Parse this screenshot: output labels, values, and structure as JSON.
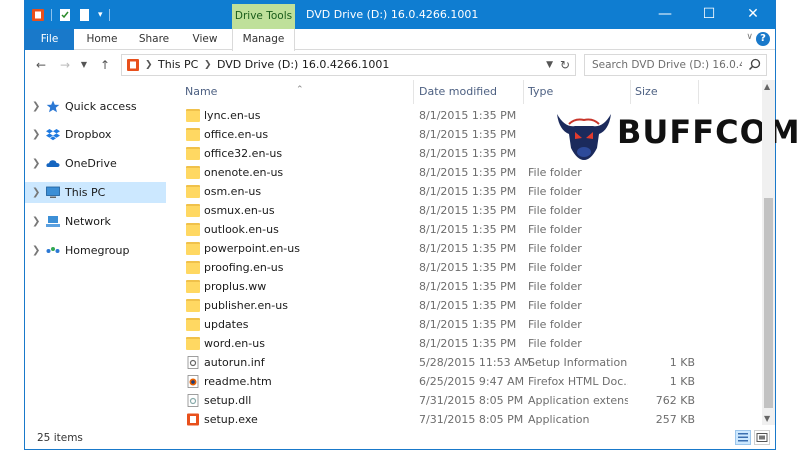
{
  "title_bar": {
    "context_tab": "Drive Tools",
    "window_title": "DVD Drive (D:) 16.0.4266.1001",
    "controls": [
      "—",
      "☐",
      "✕"
    ]
  },
  "ribbon": {
    "tabs": [
      "File",
      "Home",
      "Share",
      "View",
      "Manage"
    ]
  },
  "address": {
    "crumbs": [
      "This PC",
      "DVD Drive (D:) 16.0.4266.1001"
    ]
  },
  "search": {
    "placeholder": "Search DVD Drive (D:) 16.0.426..."
  },
  "nav_pane": {
    "items": [
      {
        "label": "Quick access",
        "icon": "star-icon"
      },
      {
        "label": "Dropbox",
        "icon": "dropbox-icon"
      },
      {
        "label": "OneDrive",
        "icon": "cloud-icon"
      },
      {
        "label": "This PC",
        "icon": "computer-icon",
        "selected": true
      },
      {
        "label": "Network",
        "icon": "network-icon"
      },
      {
        "label": "Homegroup",
        "icon": "homegroup-icon"
      }
    ]
  },
  "columns": {
    "name": "Name",
    "date": "Date modified",
    "type": "Type",
    "size": "Size"
  },
  "files": [
    {
      "name": "lync.en-us",
      "date": "8/1/2015 1:35 PM",
      "type": "",
      "size": "",
      "kind": "folder"
    },
    {
      "name": "office.en-us",
      "date": "8/1/2015 1:35 PM",
      "type": "",
      "size": "",
      "kind": "folder"
    },
    {
      "name": "office32.en-us",
      "date": "8/1/2015 1:35 PM",
      "type": "",
      "size": "",
      "kind": "folder"
    },
    {
      "name": "onenote.en-us",
      "date": "8/1/2015 1:35 PM",
      "type": "File folder",
      "size": "",
      "kind": "folder"
    },
    {
      "name": "osm.en-us",
      "date": "8/1/2015 1:35 PM",
      "type": "File folder",
      "size": "",
      "kind": "folder"
    },
    {
      "name": "osmux.en-us",
      "date": "8/1/2015 1:35 PM",
      "type": "File folder",
      "size": "",
      "kind": "folder"
    },
    {
      "name": "outlook.en-us",
      "date": "8/1/2015 1:35 PM",
      "type": "File folder",
      "size": "",
      "kind": "folder"
    },
    {
      "name": "powerpoint.en-us",
      "date": "8/1/2015 1:35 PM",
      "type": "File folder",
      "size": "",
      "kind": "folder"
    },
    {
      "name": "proofing.en-us",
      "date": "8/1/2015 1:35 PM",
      "type": "File folder",
      "size": "",
      "kind": "folder"
    },
    {
      "name": "proplus.ww",
      "date": "8/1/2015 1:35 PM",
      "type": "File folder",
      "size": "",
      "kind": "folder"
    },
    {
      "name": "publisher.en-us",
      "date": "8/1/2015 1:35 PM",
      "type": "File folder",
      "size": "",
      "kind": "folder"
    },
    {
      "name": "updates",
      "date": "8/1/2015 1:35 PM",
      "type": "File folder",
      "size": "",
      "kind": "folder"
    },
    {
      "name": "word.en-us",
      "date": "8/1/2015 1:35 PM",
      "type": "File folder",
      "size": "",
      "kind": "folder"
    },
    {
      "name": "autorun.inf",
      "date": "5/28/2015 11:53 AM",
      "type": "Setup Information",
      "size": "1 KB",
      "kind": "inf"
    },
    {
      "name": "readme.htm",
      "date": "6/25/2015 9:47 AM",
      "type": "Firefox HTML Doc...",
      "size": "1 KB",
      "kind": "htm"
    },
    {
      "name": "setup.dll",
      "date": "7/31/2015 8:05 PM",
      "type": "Application extens...",
      "size": "762 KB",
      "kind": "dll"
    },
    {
      "name": "setup.exe",
      "date": "7/31/2015 8:05 PM",
      "type": "Application",
      "size": "257 KB",
      "kind": "exe"
    }
  ],
  "status": {
    "count": "25 items"
  },
  "watermark": {
    "text": "BUFFCOM"
  },
  "colors": {
    "titlebar": "#0f7dd1",
    "file_tab": "#1979ca",
    "drive_tools": "#bfe09a",
    "selection": "#cce8ff",
    "folder": "#ffd862",
    "office": "#e8501c"
  }
}
